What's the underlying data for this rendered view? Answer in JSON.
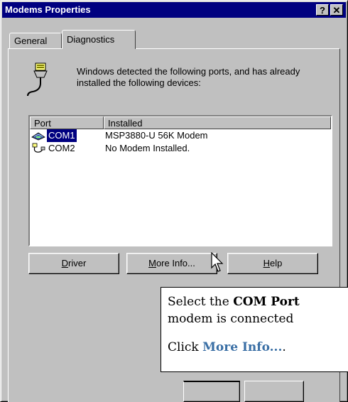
{
  "window": {
    "title": "Modems Properties",
    "help_glyph": "?",
    "close_glyph": "✕"
  },
  "tabs": [
    {
      "label": "General",
      "active": false
    },
    {
      "label": "Diagnostics",
      "active": true
    }
  ],
  "intro": {
    "text": "Windows detected the following ports, and has already installed the following devices:"
  },
  "list": {
    "columns": [
      "Port",
      "Installed"
    ],
    "rows": [
      {
        "port": "COM1",
        "installed": "MSP3880-U 56K Modem",
        "icon": "modem-icon",
        "selected": true
      },
      {
        "port": "COM2",
        "installed": "No Modem Installed.",
        "icon": "port-cable-icon",
        "selected": false
      }
    ]
  },
  "buttons": {
    "driver": {
      "prefix": "",
      "mnemonic": "D",
      "rest": "river"
    },
    "more_info": {
      "prefix": "",
      "mnemonic": "M",
      "rest": "ore Info..."
    },
    "help": {
      "prefix": "",
      "mnemonic": "H",
      "rest": "elp"
    }
  },
  "callout": {
    "line1_prefix": "Select the ",
    "line1_bold": "COM Port",
    "line2": "modem is connected",
    "line3_prefix": "Click ",
    "line3_highlight": "More Info...",
    "line3_suffix": "."
  },
  "colors": {
    "title_bar": "#000080",
    "selection": "#000080",
    "callout_highlight": "#3a6fa5",
    "face": "#c0c0c0"
  }
}
